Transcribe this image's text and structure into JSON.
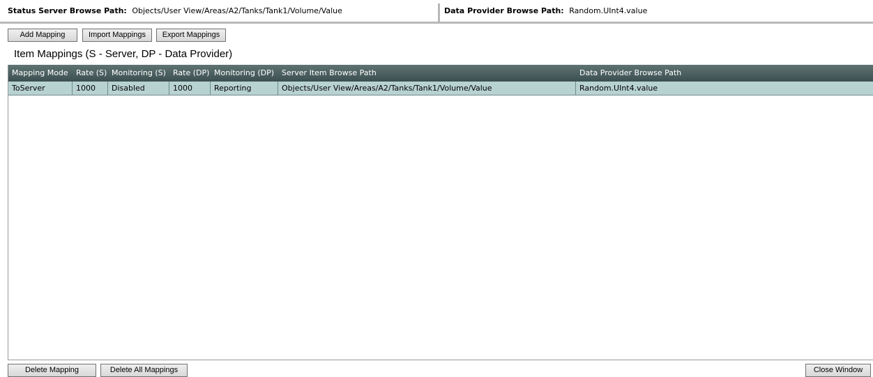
{
  "paths": {
    "status_label": "Status Server Browse Path:",
    "status_value": "Objects/User View/Areas/A2/Tanks/Tank1/Volume/Value",
    "dp_label": "Data Provider Browse Path:",
    "dp_value": "Random.UInt4.value"
  },
  "toolbar": {
    "add_label": "Add Mapping",
    "import_label": "Import Mappings",
    "export_label": "Export Mappings"
  },
  "section_title": "Item Mappings (S - Server, DP - Data Provider)",
  "table": {
    "columns": [
      "Mapping Mode",
      "Rate (S)",
      "Monitoring (S)",
      "Rate (DP)",
      "Monitoring (DP)",
      "Server Item Browse Path",
      "Data Provider Browse Path"
    ],
    "rows": [
      [
        "ToServer",
        "1000",
        "Disabled",
        "1000",
        "Reporting",
        "Objects/User View/Areas/A2/Tanks/Tank1/Volume/Value",
        "Random.UInt4.value"
      ]
    ],
    "selected_row": 0
  },
  "footer": {
    "delete_label": "Delete Mapping",
    "delete_all_label": "Delete All Mappings",
    "close_label": "Close Window"
  },
  "colors": {
    "header_bg": "#4a5f60",
    "selected_row_bg": "#b8d2d2"
  }
}
